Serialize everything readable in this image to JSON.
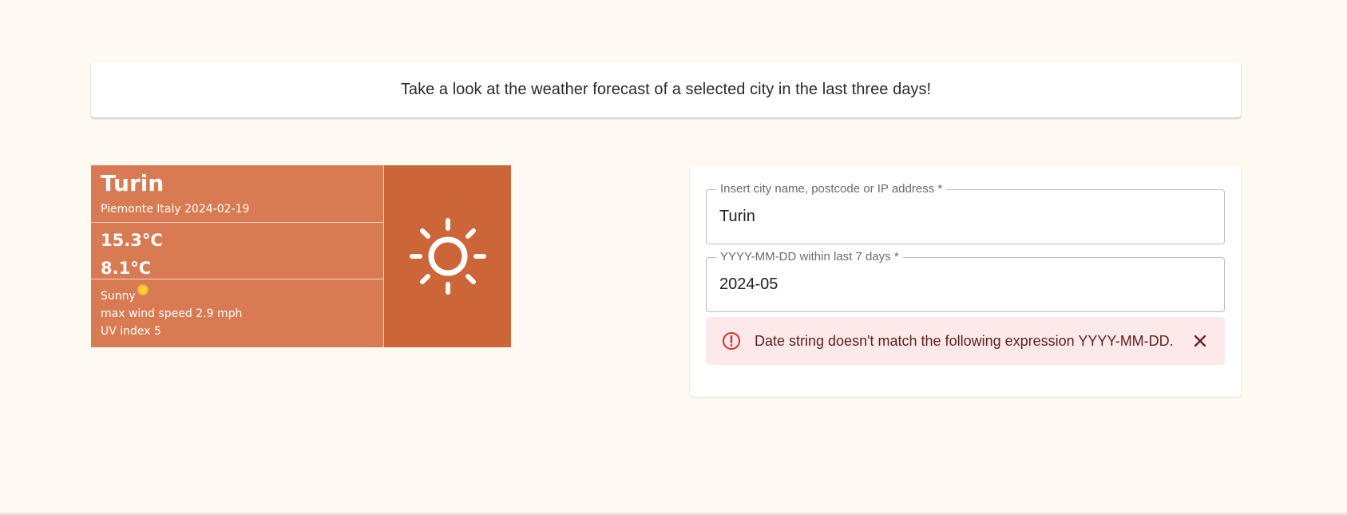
{
  "banner": {
    "text": "Take a look at the weather forecast of a selected city in the last three days!"
  },
  "weather": {
    "city": "Turin",
    "location_date": "Piemonte Italy 2024-02-19",
    "max_temp": "15.3°C",
    "min_temp": "8.1°C",
    "condition": "Sunny",
    "wind": "max wind speed 2.9 mph",
    "uv": "UV index 5",
    "main_icon": "sun-icon",
    "condition_icon": "mini-sun-icon",
    "colors": {
      "card": "#d97b52",
      "icon_panel": "#cc6538"
    }
  },
  "form": {
    "city_label": "Insert city name, postcode or IP address *",
    "city_value": "Turin",
    "date_label": "YYYY-MM-DD within last 7 days *",
    "date_value": "2024-05",
    "error_text": "Date string doesn't match the following expression YYYY-MM-DD.",
    "error_icon": "error-circle-icon",
    "close_icon": "close-icon",
    "colors": {
      "error_bg": "#fde9ea",
      "error_icon": "#d32f2f"
    }
  }
}
